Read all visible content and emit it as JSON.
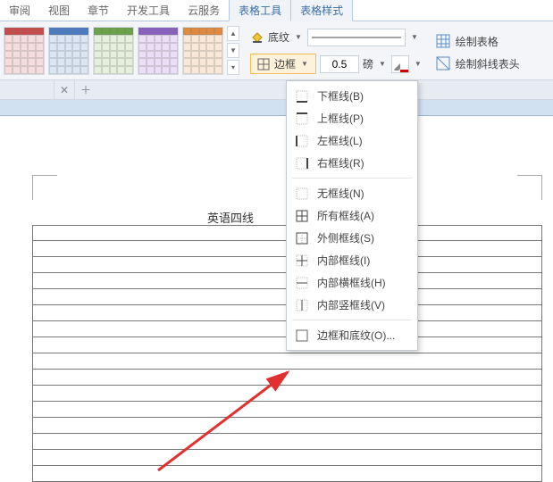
{
  "tabs": {
    "review": "审阅",
    "view": "视图",
    "chapter": "章节",
    "dev": "开发工具",
    "cloud": "云服务",
    "table_tools": "表格工具",
    "table_style": "表格样式"
  },
  "ribbon": {
    "shading_label": "底纹",
    "border_label": "边框",
    "weight_value": "0.5",
    "weight_unit": "磅",
    "draw_table": "绘制表格",
    "draw_diagonals": "绘制斜线表头"
  },
  "doc": {
    "title_fragment": "英语四线"
  },
  "border_menu": {
    "bottom": "下框线(B)",
    "top": "上框线(P)",
    "left": "左框线(L)",
    "right": "右框线(R)",
    "none": "无框线(N)",
    "all": "所有框线(A)",
    "outside": "外侧框线(S)",
    "inside": "内部框线(I)",
    "inside_h": "内部横框线(H)",
    "inside_v": "内部竖框线(V)",
    "more": "边框和底纹(O)..."
  }
}
